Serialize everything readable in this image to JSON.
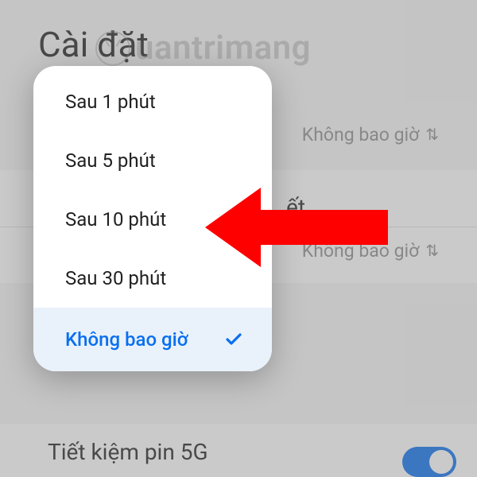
{
  "header": {
    "title": "Cài đặt"
  },
  "background": {
    "value1": "Không bao giờ",
    "value2": "Không bao giờ",
    "row_suffix": "ết",
    "battery_label": "Tiết kiệm pin 5G",
    "toggle_on": true
  },
  "popup": {
    "options": [
      {
        "label": "Sau 1 phút",
        "selected": false
      },
      {
        "label": "Sau 5 phút",
        "selected": false
      },
      {
        "label": "Sau 10 phút",
        "selected": false
      },
      {
        "label": "Sau 30 phút",
        "selected": false
      },
      {
        "label": "Không bao giờ",
        "selected": true
      }
    ]
  },
  "watermark": "uantrimang"
}
